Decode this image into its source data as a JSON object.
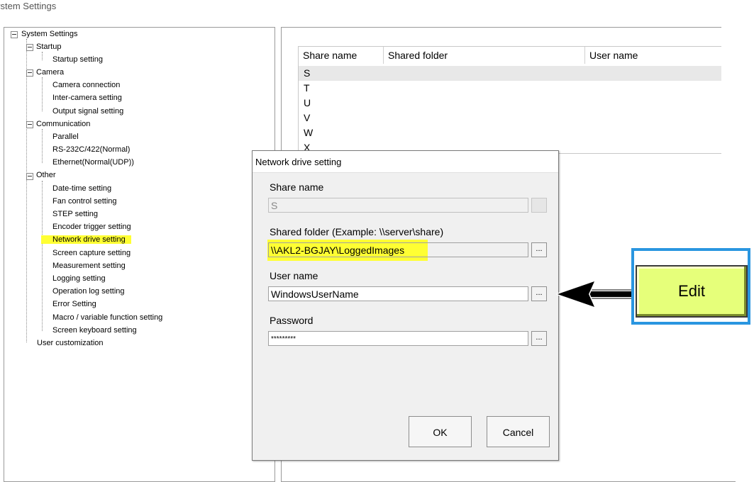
{
  "window": {
    "title": "ystem Settings"
  },
  "tree": {
    "items": [
      {
        "label": "System Settings"
      },
      {
        "label": "Startup"
      },
      {
        "label": "Startup setting"
      },
      {
        "label": "Camera"
      },
      {
        "label": "Camera connection"
      },
      {
        "label": "Inter-camera setting"
      },
      {
        "label": "Output signal setting"
      },
      {
        "label": "Communication"
      },
      {
        "label": "Parallel"
      },
      {
        "label": "RS-232C/422(Normal)"
      },
      {
        "label": "Ethernet(Normal(UDP))"
      },
      {
        "label": "Other"
      },
      {
        "label": "Date-time setting"
      },
      {
        "label": "Fan control setting"
      },
      {
        "label": "STEP setting"
      },
      {
        "label": "Encoder trigger setting"
      },
      {
        "label": "Network drive setting",
        "highlighted": true
      },
      {
        "label": "Screen capture setting"
      },
      {
        "label": "Measurement setting"
      },
      {
        "label": "Logging setting"
      },
      {
        "label": "Operation log setting"
      },
      {
        "label": "Error Setting"
      },
      {
        "label": "Macro / variable function setting"
      },
      {
        "label": "Screen keyboard setting"
      },
      {
        "label": "User customization"
      }
    ]
  },
  "share_table": {
    "columns": [
      "Share name",
      "Shared folder",
      "User name"
    ],
    "rows": [
      "S",
      "T",
      "U",
      "V",
      "W",
      "X"
    ]
  },
  "dialog": {
    "title": "Network drive setting",
    "share_name_label": "Share name",
    "share_name_value": "S",
    "shared_folder_label": "Shared folder (Example:  \\\\server\\share)",
    "shared_folder_value": "\\\\AKL2-BGJAY\\LoggedImages",
    "user_name_label": "User name",
    "user_name_value": "WindowsUserName",
    "password_label": "Password",
    "password_value": "*********",
    "browse_label": "...",
    "ok_label": "OK",
    "cancel_label": "Cancel"
  },
  "callout": {
    "edit_label": "Edit",
    "highlight_color": "#ffff33",
    "frame_color": "#2a96e0",
    "button_color": "#e6ff7a"
  }
}
